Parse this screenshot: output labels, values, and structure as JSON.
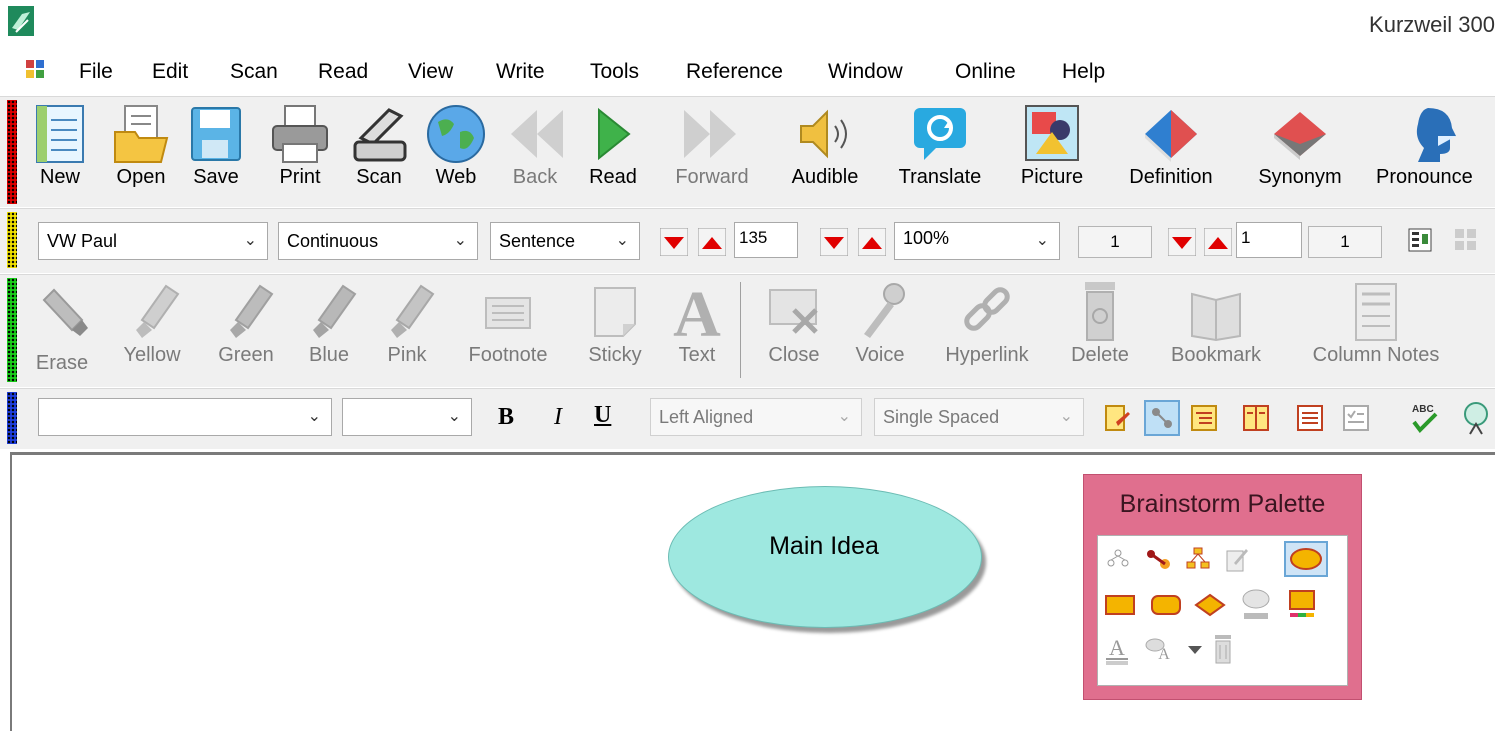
{
  "window": {
    "title": "Kurzweil 300"
  },
  "menu": {
    "items": [
      "File",
      "Edit",
      "Scan",
      "Read",
      "View",
      "Write",
      "Tools",
      "Reference",
      "Window",
      "Online",
      "Help"
    ]
  },
  "main_toolbar": {
    "buttons": [
      {
        "label": "New",
        "icon": "new-document-icon"
      },
      {
        "label": "Open",
        "icon": "open-folder-icon"
      },
      {
        "label": "Save",
        "icon": "floppy-disk-icon"
      },
      {
        "label": "Print",
        "icon": "printer-icon"
      },
      {
        "label": "Scan",
        "icon": "scanner-icon"
      },
      {
        "label": "Web",
        "icon": "globe-icon"
      },
      {
        "label": "Back",
        "icon": "rewind-icon",
        "disabled": true
      },
      {
        "label": "Read",
        "icon": "play-icon"
      },
      {
        "label": "Forward",
        "icon": "fast-forward-icon",
        "disabled": true
      },
      {
        "label": "Audible",
        "icon": "speaker-icon"
      },
      {
        "label": "Translate",
        "icon": "translate-icon"
      },
      {
        "label": "Picture",
        "icon": "picture-icon"
      },
      {
        "label": "Definition",
        "icon": "book-definition-icon"
      },
      {
        "label": "Synonym",
        "icon": "book-synonym-icon"
      },
      {
        "label": "Pronounce",
        "icon": "head-pronounce-icon"
      }
    ]
  },
  "reading_toolbar": {
    "voice": "VW Paul",
    "mode": "Continuous",
    "unit": "Sentence",
    "speed": "135",
    "zoom": "100%",
    "page": "1",
    "page_total": "1",
    "column": "1"
  },
  "highlight_toolbar": {
    "buttons": [
      {
        "label": "Erase",
        "icon": "eraser-icon"
      },
      {
        "label": "Yellow",
        "icon": "highlighter-yellow-icon"
      },
      {
        "label": "Green",
        "icon": "highlighter-green-icon"
      },
      {
        "label": "Blue",
        "icon": "highlighter-blue-icon"
      },
      {
        "label": "Pink",
        "icon": "highlighter-pink-icon"
      },
      {
        "label": "Footnote",
        "icon": "footnote-icon"
      },
      {
        "label": "Sticky",
        "icon": "sticky-note-icon"
      },
      {
        "label": "Text",
        "icon": "text-note-icon"
      },
      {
        "label": "Close",
        "icon": "close-notes-icon"
      },
      {
        "label": "Voice",
        "icon": "microphone-icon"
      },
      {
        "label": "Hyperlink",
        "icon": "hyperlink-icon"
      },
      {
        "label": "Delete",
        "icon": "trash-can-icon"
      },
      {
        "label": "Bookmark",
        "icon": "bookmark-book-icon"
      },
      {
        "label": "Column Notes",
        "icon": "column-notes-icon"
      }
    ]
  },
  "format_toolbar": {
    "font": "",
    "size": "",
    "bold": "B",
    "italic": "I",
    "underline": "U",
    "alignment": "Left Aligned",
    "spacing": "Single Spaced"
  },
  "canvas": {
    "main_idea": "Main Idea"
  },
  "palette": {
    "title": "Brainstorm Palette"
  },
  "colors": {
    "ellipse": "#9ee8e0",
    "palette": "#e06f8e",
    "accent_red": "#e00000"
  }
}
